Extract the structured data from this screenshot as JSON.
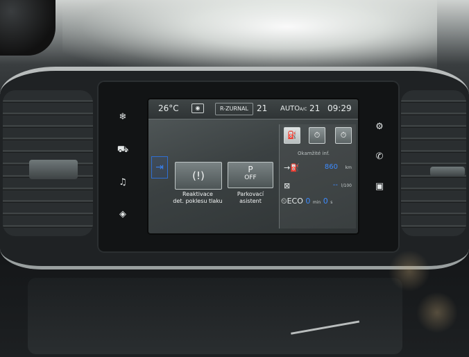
{
  "status_bar": {
    "temperature": "26°C",
    "radio_icon": "radio-icon",
    "station": "R-ZURNAL",
    "left_fan_level": "21",
    "climate_mode": "AUTO",
    "climate_mode_sub": "A/C",
    "right_fan_level": "21",
    "time": "09:29"
  },
  "main": {
    "page_icon": "page-switch-icon",
    "tiles": [
      {
        "icon": "tire-pressure-icon",
        "glyph": "(!)",
        "label_line1": "Reaktivace",
        "label_line2": "det. poklesu tlaku"
      },
      {
        "icon": "parking-assist-icon",
        "glyph": "P",
        "state": "OFF",
        "label_line1": "Parkovací",
        "label_line2": "asistent"
      }
    ]
  },
  "widget": {
    "tabs": [
      "trip-computer-icon",
      "stopwatch-1-icon",
      "stopwatch-2-icon"
    ],
    "title": "Okamžité inf.",
    "range_value": "860",
    "range_unit": "km",
    "consumption_value": "--",
    "consumption_unit": "l/100",
    "eco_label": "ECO",
    "eco_minutes": "0",
    "eco_min_unit": "min",
    "eco_seconds": "0",
    "eco_s_unit": "s"
  },
  "hardware_buttons": {
    "left": [
      "climate-icon",
      "car-icon",
      "media-icon",
      "navigation-icon"
    ],
    "right": [
      "settings-icon",
      "phone-icon",
      "apps-icon"
    ]
  },
  "colors": {
    "accent": "#3d8bff",
    "screen_bg": "#3b4142"
  }
}
